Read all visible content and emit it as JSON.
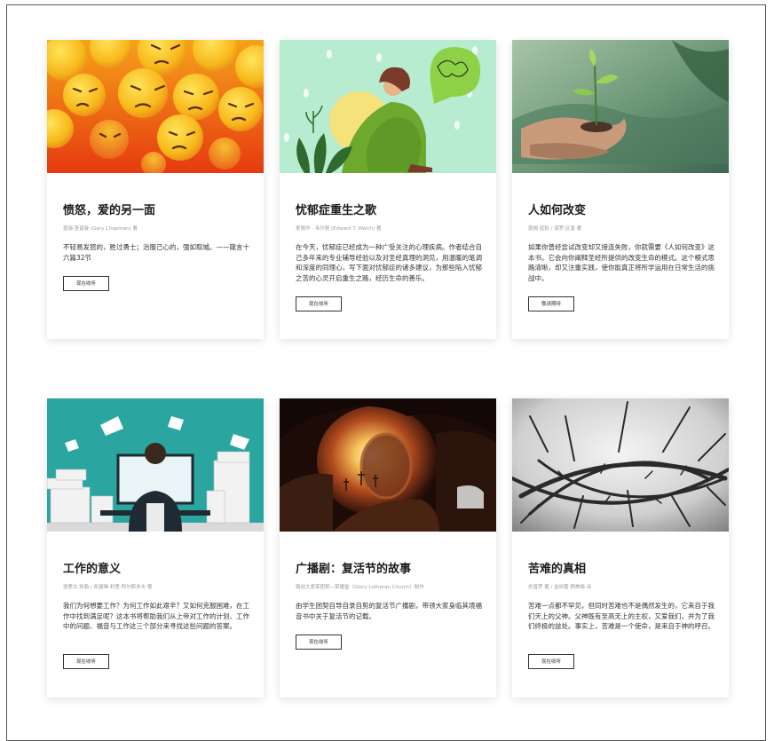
{
  "cards": [
    {
      "title": "愤怒，爱的另一面",
      "author": "盖瑞·查普曼 (Gary Chapman) 著",
      "desc": "不轻易发怒的，胜过勇士；治服己心的，强如取城。——箴言十六篇32节",
      "button": "现在收听",
      "image_icon": "angry-emoji-image"
    },
    {
      "title": "忧郁症重生之歌",
      "author": "爱德华 · 韦尔契 (Edward T. Welch) 著",
      "desc": "在今天，忧郁症已经成为一种广受关注的心理疾病。作者结合自己多年来的专业辅导经验以及对圣经真理的洞见，用温暖的笔调和深度的同理心，写下面对忧郁症的诸多建议，为那些陷入忧郁之苦的心灵开启重生之路，经历生命的善乐。",
      "button": "现在收听",
      "image_icon": "sad-woman-illustration"
    },
    {
      "title": "人如何改变",
      "author": "提姆·蓝狄 / 保罗·区普 著",
      "desc": "如果你曾经尝试改变却又接连失败，你就需要《人如何改变》这本书。它会向你阐释圣经所提供的改变生命的模式。这个模式思路清晰，却又注重实践，使你能真正将所学运用在日常生活的挑战中。",
      "button": "敬请期待",
      "image_icon": "hands-sprout-photo"
    },
    {
      "title": "工作的意义",
      "author": "提摩太·凯勒 / 凯瑟琳·利里·阿尔斯多夫 著",
      "desc": "我们为何想要工作？为何工作如此艰辛？又如何克服困难，在工作中找到满足呢？这本书将帮助我们从上帝对工作的计划、工作中的问题、福音与工作这三个部分来寻找这些问题的答案。",
      "button": "现在收听",
      "image_icon": "office-worker-illustration"
    },
    {
      "title": "广播剧：复活节的故事",
      "author": "路加大爱荣团契—荣耀堂（Glory Lutheran Church）制作",
      "desc": "由学生团契自导自录自剪的复活节广播剧，带领大家身临其境福音书中关于复活节的记载。",
      "button": "现在收听",
      "image_icon": "empty-tomb-photo"
    },
    {
      "title": "苦难的真相",
      "author": "史普罗 著 / 金欣蕾 顾美梅 译",
      "desc": "苦难一点都不罕见，但同时苦难也不是偶然发生的，它来自于我们天上的父神。父神既有至高无上的主权，又爱我们，并为了我们终极的益处。事实上，苦难是一个使命，是来自于神的呼召。",
      "button": "现在收听",
      "image_icon": "crown-of-thorns-photo"
    }
  ]
}
